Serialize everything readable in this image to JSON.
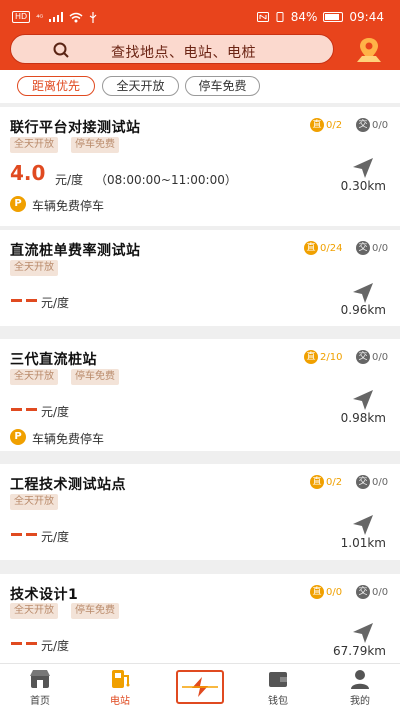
{
  "status_bar": {
    "left_badges": [
      "HD",
      "⁴ᴳ"
    ],
    "battery": "84%",
    "time": "09:44"
  },
  "search": {
    "placeholder": "查找地点、电站、电桩",
    "search_icon": "search-icon",
    "map_icon": "map-pin-icon"
  },
  "filters": [
    {
      "label": "距离优先",
      "active": true
    },
    {
      "label": "全天开放",
      "active": false
    },
    {
      "label": "停车免费",
      "active": false
    }
  ],
  "stations": [
    {
      "name": "联行平台对接测试站",
      "dc_label": "直",
      "dc": "0/2",
      "ac_label": "交",
      "ac": "0/0",
      "tags": [
        "全天开放",
        "停车免费"
      ],
      "price": "4.0",
      "unit": "元/度",
      "hours": "（08:00:00~11:00:00）",
      "distance": "0.30km",
      "parking": "车辆免费停车"
    },
    {
      "name": "直流桩单费率测试站",
      "dc_label": "直",
      "dc": "0/24",
      "ac_label": "交",
      "ac": "0/0",
      "tags": [
        "全天开放"
      ],
      "price": "",
      "unit": "元/度",
      "distance": "0.96km"
    },
    {
      "name": "三代直流桩站",
      "dc_label": "直",
      "dc": "2/10",
      "ac_label": "交",
      "ac": "0/0",
      "tags": [
        "全天开放",
        "停车免费"
      ],
      "price": "",
      "unit": "元/度",
      "distance": "0.98km",
      "parking": "车辆免费停车"
    },
    {
      "name": "工程技术测试站点",
      "dc_label": "直",
      "dc": "0/2",
      "ac_label": "交",
      "ac": "0/0",
      "tags": [
        "全天开放"
      ],
      "price": "",
      "unit": "元/度",
      "distance": "1.01km"
    },
    {
      "name": "技术设计1",
      "dc_label": "直",
      "dc": "0/0",
      "ac_label": "交",
      "ac": "0/0",
      "tags": [
        "全天开放",
        "停车免费"
      ],
      "price": "",
      "unit": "元/度",
      "distance": "67.79km"
    }
  ],
  "parking_icon_label": "P",
  "tabbar": [
    {
      "label": "首页",
      "icon": "home-icon",
      "active": false
    },
    {
      "label": "电站",
      "icon": "charging-station-icon",
      "active": true
    },
    {
      "label": "",
      "icon": "scan-icon",
      "active": false
    },
    {
      "label": "钱包",
      "icon": "wallet-icon",
      "active": false
    },
    {
      "label": "我的",
      "icon": "user-icon",
      "active": false
    }
  ],
  "colors": {
    "brand": "#e8441c",
    "accent": "#e04a20",
    "dc": "#f0a000"
  }
}
